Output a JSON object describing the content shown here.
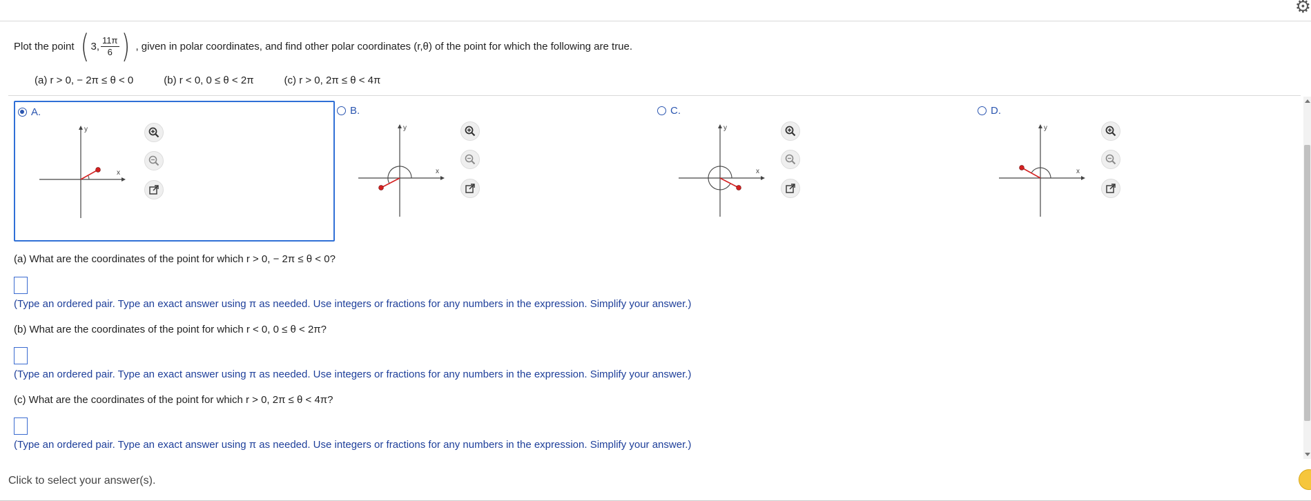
{
  "question": {
    "prefix": "Plot the point",
    "point_r": "3,",
    "point_num": "11π",
    "point_den": "6",
    "suffix": ", given in polar coordinates, and find other polar coordinates (r,θ) of the point for which the following are true."
  },
  "conditions": [
    "(a) r > 0,  − 2π ≤ θ < 0",
    "(b) r < 0, 0 ≤ θ < 2π",
    "(c) r > 0, 2π ≤ θ < 4π"
  ],
  "options": [
    {
      "label": "A.",
      "selected": true
    },
    {
      "label": "B.",
      "selected": false
    },
    {
      "label": "C.",
      "selected": false
    },
    {
      "label": "D.",
      "selected": false
    }
  ],
  "graph_axis_labels": {
    "x": "x",
    "y": "y"
  },
  "graph_icons": [
    "zoom-in-icon",
    "zoom-out-icon",
    "open-new-window-icon"
  ],
  "parts": [
    {
      "question": "(a) What are the coordinates of the point for which r > 0,  − 2π ≤ θ < 0?",
      "hint": "(Type an ordered pair. Type an exact answer using π as needed. Use integers or fractions for any numbers in the expression. Simplify your answer.)"
    },
    {
      "question": "(b) What are the coordinates of the point for which r < 0, 0 ≤ θ < 2π?",
      "hint": "(Type an ordered pair. Type an exact answer using π as needed. Use integers or fractions for any numbers in the expression. Simplify your answer.)"
    },
    {
      "question": "(c) What are the coordinates of the point for which r > 0, 2π ≤ θ < 4π?",
      "hint": "(Type an ordered pair. Type an exact answer using π as needed. Use integers or fractions for any numbers in the expression. Simplify your answer.)"
    }
  ],
  "footer": "Click to select your answer(s).",
  "colors": {
    "accent": "#2b56b0",
    "hint": "#1e3f9a",
    "point": "#d42020"
  }
}
